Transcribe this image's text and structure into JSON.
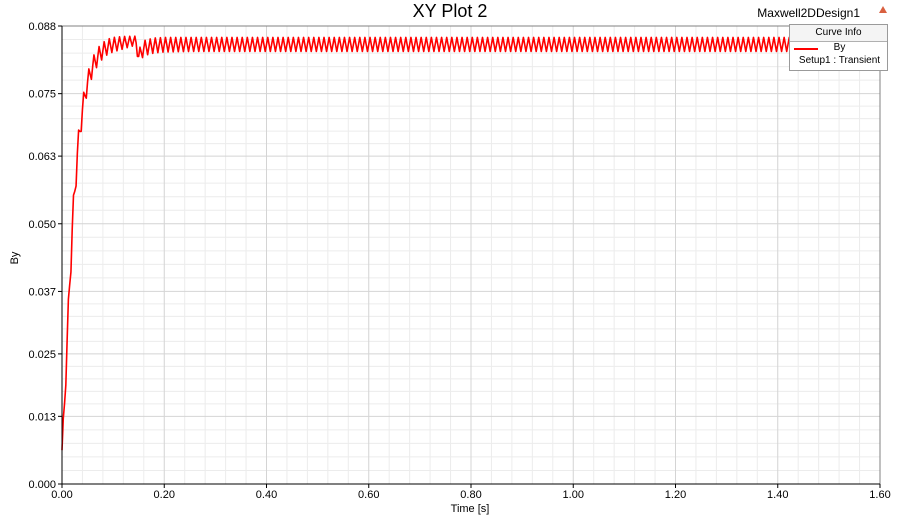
{
  "header": {
    "design_name": "Maxwell2DDesign1",
    "corner_icon": "up-triangle-icon"
  },
  "legend": {
    "title": "Curve Info",
    "series_name": "By",
    "setup": "Setup1 : Transient"
  },
  "colors": {
    "series": "#ff0000",
    "grid_major": "#d4d4d4",
    "grid_minor": "#ececec",
    "axis": "#000000"
  },
  "chart_data": {
    "type": "line",
    "title": "XY Plot 2",
    "xlabel": "Time [s]",
    "ylabel": "By",
    "xlim": [
      0.0,
      1.6
    ],
    "ylim": [
      0.0,
      0.088
    ],
    "x_ticks": [
      0.0,
      0.2,
      0.4,
      0.6,
      0.8,
      1.0,
      1.2,
      1.4,
      1.6
    ],
    "x_tick_labels": [
      "0.00",
      "0.20",
      "0.40",
      "0.60",
      "0.80",
      "1.00",
      "1.20",
      "1.40",
      "1.60"
    ],
    "y_ticks": [
      0.0,
      0.013,
      0.025,
      0.037,
      0.05,
      0.063,
      0.075,
      0.088
    ],
    "y_tick_labels": [
      "0.000",
      "0.013",
      "0.025",
      "0.037",
      "0.050",
      "0.063",
      "0.075",
      "0.088"
    ],
    "grid": true,
    "legend_position": "top-right",
    "series": [
      {
        "name": "By",
        "color": "#ff0000",
        "envelope": {
          "x": [
            0.0,
            0.005,
            0.01,
            0.02,
            0.03,
            0.04,
            0.05,
            0.06,
            0.07,
            0.08,
            0.09,
            0.1,
            0.11,
            0.12,
            0.13,
            0.14,
            0.145,
            0.15,
            0.16,
            0.18,
            0.2,
            0.25,
            0.3,
            0.5,
            1.0,
            1.5,
            1.6
          ],
          "upper": [
            0.0072,
            0.018,
            0.03,
            0.052,
            0.066,
            0.074,
            0.079,
            0.082,
            0.0838,
            0.0848,
            0.0855,
            0.0858,
            0.0859,
            0.086,
            0.086,
            0.0861,
            0.086,
            0.0835,
            0.0852,
            0.0857,
            0.0858,
            0.0858,
            0.0858,
            0.0858,
            0.0858,
            0.0858,
            0.0858
          ],
          "lower": [
            0.0058,
            0.013,
            0.025,
            0.046,
            0.061,
            0.07,
            0.0755,
            0.0785,
            0.0805,
            0.0818,
            0.0826,
            0.083,
            0.0833,
            0.0836,
            0.0839,
            0.0842,
            0.0835,
            0.0808,
            0.0823,
            0.0828,
            0.083,
            0.0831,
            0.0831,
            0.0831,
            0.0831,
            0.0831,
            0.0831
          ]
        },
        "oscillation_period": 0.01
      }
    ]
  }
}
